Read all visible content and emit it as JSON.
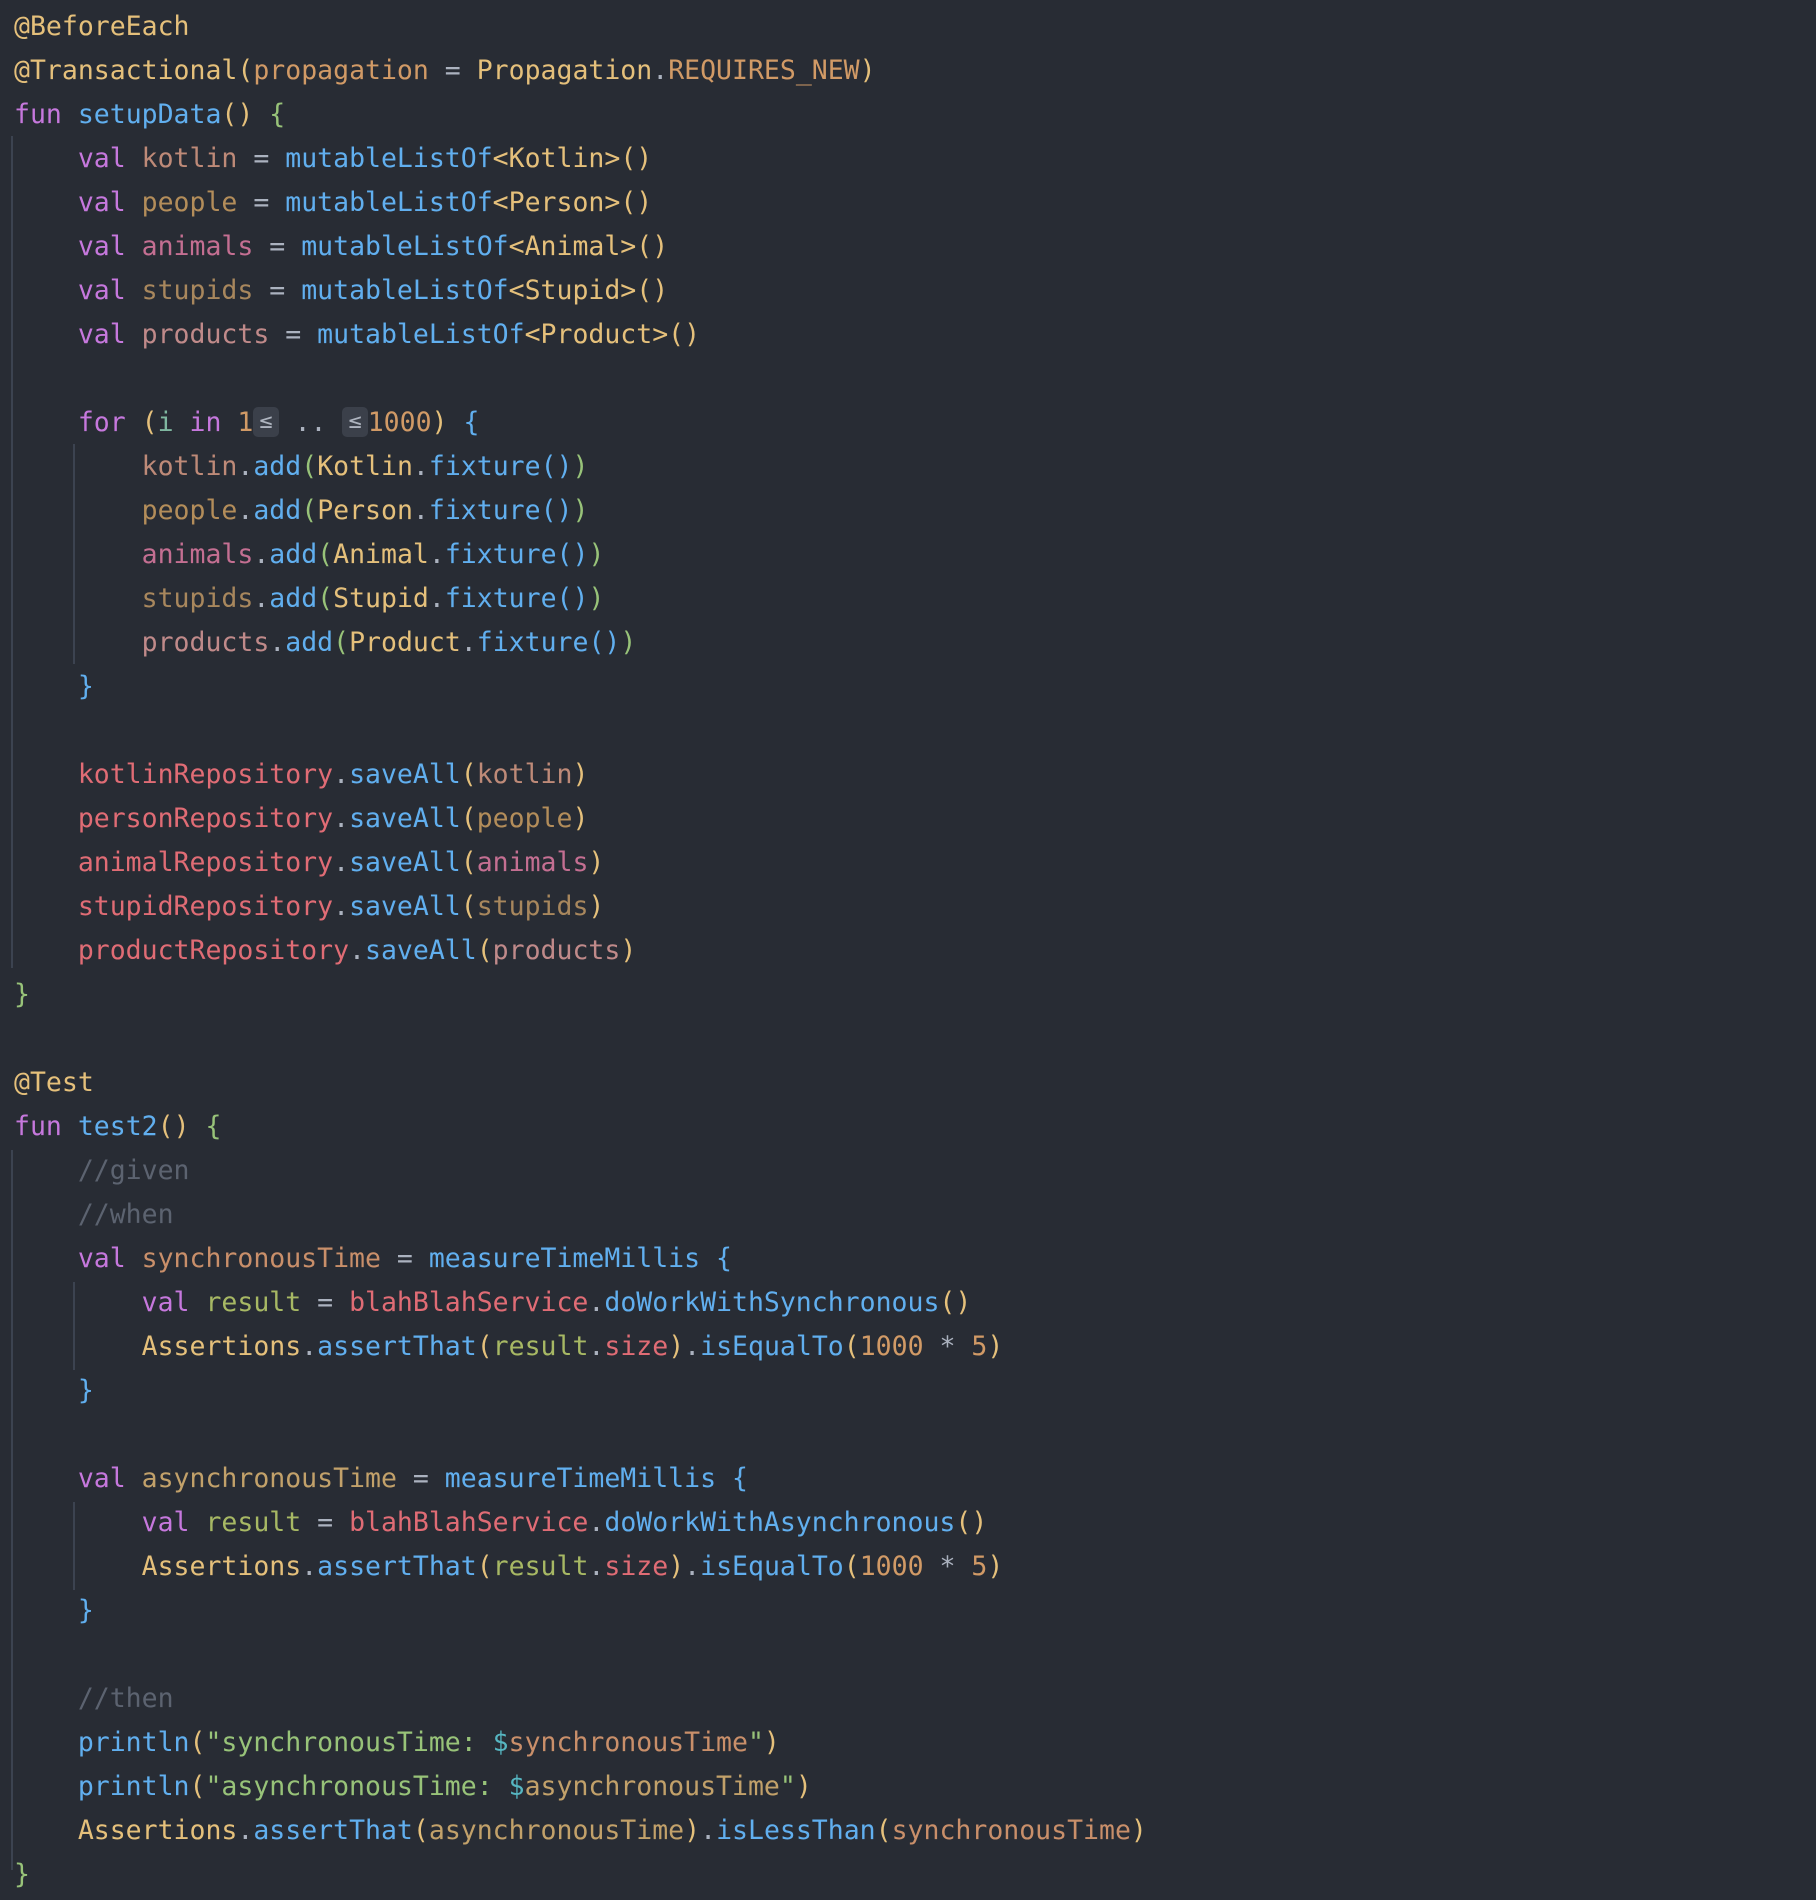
{
  "lines": [
    [
      {
        "t": "@BeforeEach",
        "c": "ann"
      }
    ],
    [
      {
        "t": "@Transactional",
        "c": "ann"
      },
      {
        "t": "(",
        "c": "y"
      },
      {
        "t": "propagation",
        "c": "prp"
      },
      {
        "t": " = ",
        "c": "op"
      },
      {
        "t": "Propagation",
        "c": "cls"
      },
      {
        "t": ".",
        "c": "op"
      },
      {
        "t": "REQUIRES_NEW",
        "c": "prp"
      },
      {
        "t": ")",
        "c": "y"
      }
    ],
    [
      {
        "t": "fun ",
        "c": "kw"
      },
      {
        "t": "setupData",
        "c": "fn"
      },
      {
        "t": "()",
        "c": "y"
      },
      {
        "t": " {",
        "c": "g"
      }
    ],
    [
      {
        "t": "    val ",
        "c": "kw"
      },
      {
        "t": "kotlin",
        "c": "v1"
      },
      {
        "t": " = ",
        "c": "op"
      },
      {
        "t": "mutableListOf",
        "c": "fn"
      },
      {
        "t": "<Kotlin>",
        "c": "cls"
      },
      {
        "t": "()",
        "c": "y"
      }
    ],
    [
      {
        "t": "    val ",
        "c": "kw"
      },
      {
        "t": "people",
        "c": "v2"
      },
      {
        "t": " = ",
        "c": "op"
      },
      {
        "t": "mutableListOf",
        "c": "fn"
      },
      {
        "t": "<Person>",
        "c": "cls"
      },
      {
        "t": "()",
        "c": "y"
      }
    ],
    [
      {
        "t": "    val ",
        "c": "kw"
      },
      {
        "t": "animals",
        "c": "v3"
      },
      {
        "t": " = ",
        "c": "op"
      },
      {
        "t": "mutableListOf",
        "c": "fn"
      },
      {
        "t": "<Animal>",
        "c": "cls"
      },
      {
        "t": "()",
        "c": "y"
      }
    ],
    [
      {
        "t": "    val ",
        "c": "kw"
      },
      {
        "t": "stupids",
        "c": "v4"
      },
      {
        "t": " = ",
        "c": "op"
      },
      {
        "t": "mutableListOf",
        "c": "fn"
      },
      {
        "t": "<Stupid>",
        "c": "cls"
      },
      {
        "t": "()",
        "c": "y"
      }
    ],
    [
      {
        "t": "    val ",
        "c": "kw"
      },
      {
        "t": "products",
        "c": "v5"
      },
      {
        "t": " = ",
        "c": "op"
      },
      {
        "t": "mutableListOf",
        "c": "fn"
      },
      {
        "t": "<Product>",
        "c": "cls"
      },
      {
        "t": "()",
        "c": "y"
      }
    ],
    [],
    [
      {
        "t": "    for ",
        "c": "kw"
      },
      {
        "t": "(",
        "c": "y"
      },
      {
        "t": "i",
        "c": "vL"
      },
      {
        "t": " in ",
        "c": "kw"
      },
      {
        "t": "1",
        "c": "num"
      },
      {
        "t": "≤",
        "c": "hint"
      },
      {
        "t": " .. ",
        "c": "op"
      },
      {
        "t": "≤",
        "c": "hint"
      },
      {
        "t": "1000",
        "c": "num"
      },
      {
        "t": ")",
        "c": "y"
      },
      {
        "t": " {",
        "c": "b"
      }
    ],
    [
      {
        "t": "        kotlin",
        "c": "v1"
      },
      {
        "t": ".",
        "c": "op"
      },
      {
        "t": "add",
        "c": "fn"
      },
      {
        "t": "(",
        "c": "g"
      },
      {
        "t": "Kotlin",
        "c": "cls"
      },
      {
        "t": ".",
        "c": "op"
      },
      {
        "t": "fixture",
        "c": "fn"
      },
      {
        "t": "()",
        "c": "b"
      },
      {
        "t": ")",
        "c": "g"
      }
    ],
    [
      {
        "t": "        people",
        "c": "v2"
      },
      {
        "t": ".",
        "c": "op"
      },
      {
        "t": "add",
        "c": "fn"
      },
      {
        "t": "(",
        "c": "g"
      },
      {
        "t": "Person",
        "c": "cls"
      },
      {
        "t": ".",
        "c": "op"
      },
      {
        "t": "fixture",
        "c": "fn"
      },
      {
        "t": "()",
        "c": "b"
      },
      {
        "t": ")",
        "c": "g"
      }
    ],
    [
      {
        "t": "        animals",
        "c": "v3"
      },
      {
        "t": ".",
        "c": "op"
      },
      {
        "t": "add",
        "c": "fn"
      },
      {
        "t": "(",
        "c": "g"
      },
      {
        "t": "Animal",
        "c": "cls"
      },
      {
        "t": ".",
        "c": "op"
      },
      {
        "t": "fixture",
        "c": "fn"
      },
      {
        "t": "()",
        "c": "b"
      },
      {
        "t": ")",
        "c": "g"
      }
    ],
    [
      {
        "t": "        stupids",
        "c": "v4"
      },
      {
        "t": ".",
        "c": "op"
      },
      {
        "t": "add",
        "c": "fn"
      },
      {
        "t": "(",
        "c": "g"
      },
      {
        "t": "Stupid",
        "c": "cls"
      },
      {
        "t": ".",
        "c": "op"
      },
      {
        "t": "fixture",
        "c": "fn"
      },
      {
        "t": "()",
        "c": "b"
      },
      {
        "t": ")",
        "c": "g"
      }
    ],
    [
      {
        "t": "        products",
        "c": "v5"
      },
      {
        "t": ".",
        "c": "op"
      },
      {
        "t": "add",
        "c": "fn"
      },
      {
        "t": "(",
        "c": "g"
      },
      {
        "t": "Product",
        "c": "cls"
      },
      {
        "t": ".",
        "c": "op"
      },
      {
        "t": "fixture",
        "c": "fn"
      },
      {
        "t": "()",
        "c": "b"
      },
      {
        "t": ")",
        "c": "g"
      }
    ],
    [
      {
        "t": "    }",
        "c": "b"
      }
    ],
    [],
    [
      {
        "t": "    kotlinRepository",
        "c": "fld"
      },
      {
        "t": ".",
        "c": "op"
      },
      {
        "t": "saveAll",
        "c": "fn"
      },
      {
        "t": "(",
        "c": "y"
      },
      {
        "t": "kotlin",
        "c": "v1"
      },
      {
        "t": ")",
        "c": "y"
      }
    ],
    [
      {
        "t": "    personRepository",
        "c": "fld"
      },
      {
        "t": ".",
        "c": "op"
      },
      {
        "t": "saveAll",
        "c": "fn"
      },
      {
        "t": "(",
        "c": "y"
      },
      {
        "t": "people",
        "c": "v2"
      },
      {
        "t": ")",
        "c": "y"
      }
    ],
    [
      {
        "t": "    animalRepository",
        "c": "fld"
      },
      {
        "t": ".",
        "c": "op"
      },
      {
        "t": "saveAll",
        "c": "fn"
      },
      {
        "t": "(",
        "c": "y"
      },
      {
        "t": "animals",
        "c": "v3"
      },
      {
        "t": ")",
        "c": "y"
      }
    ],
    [
      {
        "t": "    stupidRepository",
        "c": "fld"
      },
      {
        "t": ".",
        "c": "op"
      },
      {
        "t": "saveAll",
        "c": "fn"
      },
      {
        "t": "(",
        "c": "y"
      },
      {
        "t": "stupids",
        "c": "v4"
      },
      {
        "t": ")",
        "c": "y"
      }
    ],
    [
      {
        "t": "    productRepository",
        "c": "fld"
      },
      {
        "t": ".",
        "c": "op"
      },
      {
        "t": "saveAll",
        "c": "fn"
      },
      {
        "t": "(",
        "c": "y"
      },
      {
        "t": "products",
        "c": "v5"
      },
      {
        "t": ")",
        "c": "y"
      }
    ],
    [
      {
        "t": "}",
        "c": "g"
      }
    ],
    [],
    [
      {
        "t": "@Test",
        "c": "ann"
      }
    ],
    [
      {
        "t": "fun ",
        "c": "kw"
      },
      {
        "t": "test2",
        "c": "fn"
      },
      {
        "t": "()",
        "c": "y"
      },
      {
        "t": " {",
        "c": "g"
      }
    ],
    [
      {
        "t": "    //given",
        "c": "cmt"
      }
    ],
    [
      {
        "t": "    //when",
        "c": "cmt"
      }
    ],
    [
      {
        "t": "    val ",
        "c": "kw"
      },
      {
        "t": "synchronousTime",
        "c": "vs"
      },
      {
        "t": " = ",
        "c": "op"
      },
      {
        "t": "measureTimeMillis",
        "c": "fn"
      },
      {
        "t": " {",
        "c": "b"
      }
    ],
    [
      {
        "t": "        val ",
        "c": "kw"
      },
      {
        "t": "result",
        "c": "vr"
      },
      {
        "t": " = ",
        "c": "op"
      },
      {
        "t": "blahBlahService",
        "c": "fld"
      },
      {
        "t": ".",
        "c": "op"
      },
      {
        "t": "doWorkWithSynchronous",
        "c": "fn"
      },
      {
        "t": "()",
        "c": "y"
      }
    ],
    [
      {
        "t": "        Assertions",
        "c": "cls"
      },
      {
        "t": ".",
        "c": "op"
      },
      {
        "t": "assertThat",
        "c": "fn"
      },
      {
        "t": "(",
        "c": "y"
      },
      {
        "t": "result",
        "c": "vr"
      },
      {
        "t": ".",
        "c": "op"
      },
      {
        "t": "size",
        "c": "fld"
      },
      {
        "t": ")",
        "c": "y"
      },
      {
        "t": ".",
        "c": "op"
      },
      {
        "t": "isEqualTo",
        "c": "fn"
      },
      {
        "t": "(",
        "c": "y"
      },
      {
        "t": "1000",
        "c": "num"
      },
      {
        "t": " * ",
        "c": "op"
      },
      {
        "t": "5",
        "c": "num"
      },
      {
        "t": ")",
        "c": "y"
      }
    ],
    [
      {
        "t": "    }",
        "c": "b"
      }
    ],
    [],
    [
      {
        "t": "    val ",
        "c": "kw"
      },
      {
        "t": "asynchronousTime",
        "c": "va"
      },
      {
        "t": " = ",
        "c": "op"
      },
      {
        "t": "measureTimeMillis",
        "c": "fn"
      },
      {
        "t": " {",
        "c": "b"
      }
    ],
    [
      {
        "t": "        val ",
        "c": "kw"
      },
      {
        "t": "result",
        "c": "vr"
      },
      {
        "t": " = ",
        "c": "op"
      },
      {
        "t": "blahBlahService",
        "c": "fld"
      },
      {
        "t": ".",
        "c": "op"
      },
      {
        "t": "doWorkWithAsynchronous",
        "c": "fn"
      },
      {
        "t": "()",
        "c": "y"
      }
    ],
    [
      {
        "t": "        Assertions",
        "c": "cls"
      },
      {
        "t": ".",
        "c": "op"
      },
      {
        "t": "assertThat",
        "c": "fn"
      },
      {
        "t": "(",
        "c": "y"
      },
      {
        "t": "result",
        "c": "vr"
      },
      {
        "t": ".",
        "c": "op"
      },
      {
        "t": "size",
        "c": "fld"
      },
      {
        "t": ")",
        "c": "y"
      },
      {
        "t": ".",
        "c": "op"
      },
      {
        "t": "isEqualTo",
        "c": "fn"
      },
      {
        "t": "(",
        "c": "y"
      },
      {
        "t": "1000",
        "c": "num"
      },
      {
        "t": " * ",
        "c": "op"
      },
      {
        "t": "5",
        "c": "num"
      },
      {
        "t": ")",
        "c": "y"
      }
    ],
    [
      {
        "t": "    }",
        "c": "b"
      }
    ],
    [],
    [
      {
        "t": "    //then",
        "c": "cmt"
      }
    ],
    [
      {
        "t": "    println",
        "c": "fn"
      },
      {
        "t": "(",
        "c": "y"
      },
      {
        "t": "\"synchronousTime: ",
        "c": "str"
      },
      {
        "t": "$",
        "c": "tpl"
      },
      {
        "t": "synchronousTime",
        "c": "vs"
      },
      {
        "t": "\"",
        "c": "str"
      },
      {
        "t": ")",
        "c": "y"
      }
    ],
    [
      {
        "t": "    println",
        "c": "fn"
      },
      {
        "t": "(",
        "c": "y"
      },
      {
        "t": "\"asynchronousTime: ",
        "c": "str"
      },
      {
        "t": "$",
        "c": "tpl"
      },
      {
        "t": "asynchronousTime",
        "c": "va"
      },
      {
        "t": "\"",
        "c": "str"
      },
      {
        "t": ")",
        "c": "y"
      }
    ],
    [
      {
        "t": "    Assertions",
        "c": "cls"
      },
      {
        "t": ".",
        "c": "op"
      },
      {
        "t": "assertThat",
        "c": "fn"
      },
      {
        "t": "(",
        "c": "y"
      },
      {
        "t": "asynchronousTime",
        "c": "va"
      },
      {
        "t": ")",
        "c": "y"
      },
      {
        "t": ".",
        "c": "op"
      },
      {
        "t": "isLessThan",
        "c": "fn"
      },
      {
        "t": "(",
        "c": "y"
      },
      {
        "t": "synchronousTime",
        "c": "vs"
      },
      {
        "t": ")",
        "c": "y"
      }
    ],
    [
      {
        "t": "}",
        "c": "g"
      }
    ]
  ]
}
